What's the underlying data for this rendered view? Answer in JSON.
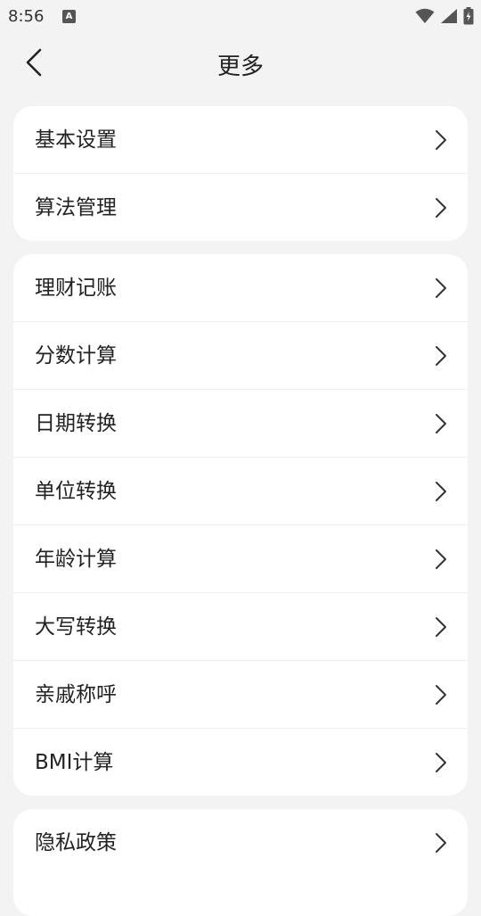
{
  "status_bar": {
    "time": "8:56",
    "notification_icon": "accessibility-a-icon",
    "icons": [
      "wifi-icon",
      "signal-icon",
      "battery-charging-icon"
    ]
  },
  "header": {
    "title": "更多",
    "back_icon": "chevron-left-icon"
  },
  "sections": [
    {
      "items": [
        {
          "label": "基本设置"
        },
        {
          "label": "算法管理"
        }
      ]
    },
    {
      "items": [
        {
          "label": "理财记账"
        },
        {
          "label": "分数计算"
        },
        {
          "label": "日期转换"
        },
        {
          "label": "单位转换"
        },
        {
          "label": "年龄计算"
        },
        {
          "label": "大写转换"
        },
        {
          "label": "亲戚称呼"
        },
        {
          "label": "BMI计算"
        }
      ]
    },
    {
      "items": [
        {
          "label": "隐私政策"
        }
      ]
    }
  ],
  "row_icon": "chevron-right-icon"
}
